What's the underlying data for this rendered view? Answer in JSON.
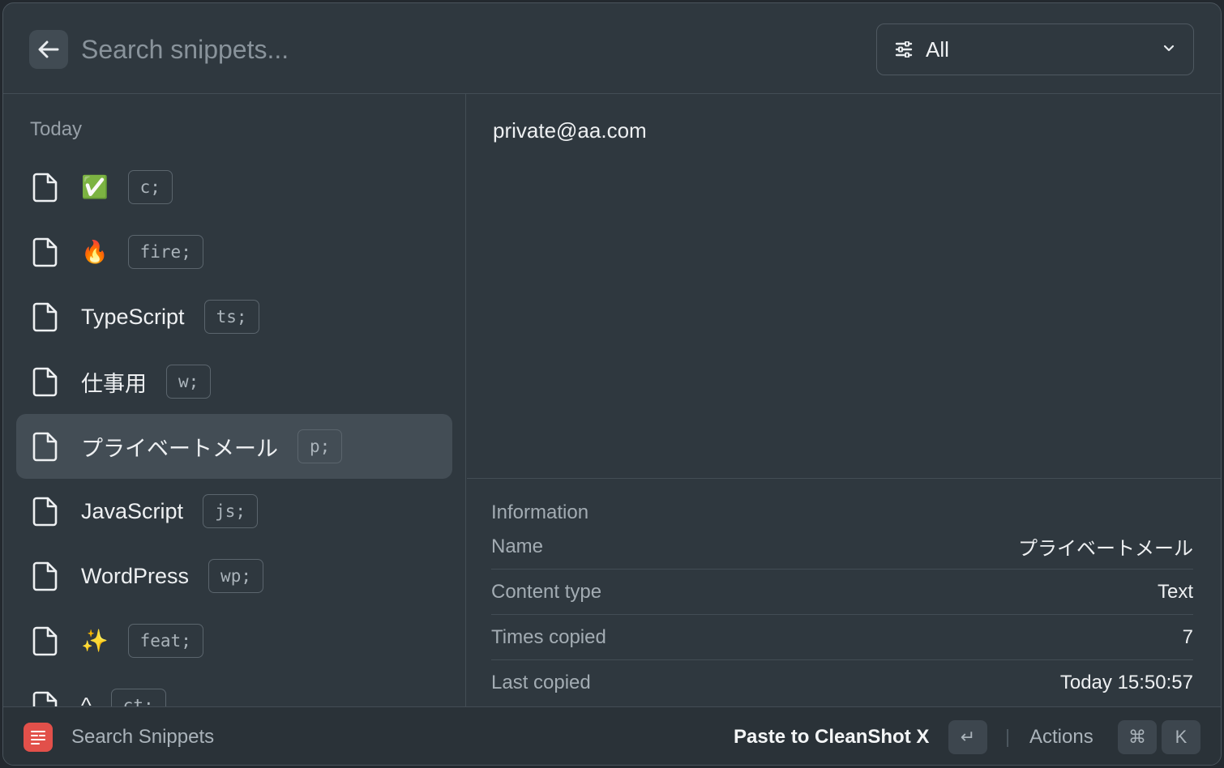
{
  "header": {
    "back_icon": "arrow-left-icon",
    "search_placeholder": "Search snippets...",
    "search_value": "",
    "filter": {
      "icon": "filter-lines-icon",
      "label": "All",
      "chevron_icon": "chevron-down-icon"
    }
  },
  "list": {
    "section_title": "Today",
    "items": [
      {
        "title": "✅",
        "keyword": "c;",
        "icon": "document-icon"
      },
      {
        "title": "🔥",
        "keyword": "fire;",
        "icon": "document-icon"
      },
      {
        "title": "TypeScript",
        "keyword": "ts;",
        "icon": "document-icon"
      },
      {
        "title": "仕事用",
        "keyword": "w;",
        "icon": "document-icon"
      },
      {
        "title": "プライベートメール",
        "keyword": "p;",
        "icon": "document-icon",
        "selected": true
      },
      {
        "title": "JavaScript",
        "keyword": "js;",
        "icon": "document-icon"
      },
      {
        "title": "WordPress",
        "keyword": "wp;",
        "icon": "document-icon"
      },
      {
        "title": "✨",
        "keyword": "feat;",
        "icon": "document-icon"
      },
      {
        "title": "^",
        "keyword": "ct;",
        "icon": "document-icon"
      }
    ]
  },
  "detail": {
    "preview_text": "private@aa.com",
    "info_title": "Information",
    "info": [
      {
        "key": "Name",
        "value": "プライベートメール"
      },
      {
        "key": "Content type",
        "value": "Text"
      },
      {
        "key": "Times copied",
        "value": "7"
      },
      {
        "key": "Last copied",
        "value": "Today 15:50:57"
      }
    ]
  },
  "footer": {
    "app_icon": "snippets-app-icon",
    "title": "Search Snippets",
    "primary_action": "Paste to CleanShot X",
    "enter_key": "↵",
    "actions_label": "Actions",
    "cmd_key": "⌘",
    "k_key": "K"
  },
  "colors": {
    "window_bg": "#2f383f",
    "selected_bg": "#434d55",
    "app_icon_bg": "#e2504a"
  }
}
